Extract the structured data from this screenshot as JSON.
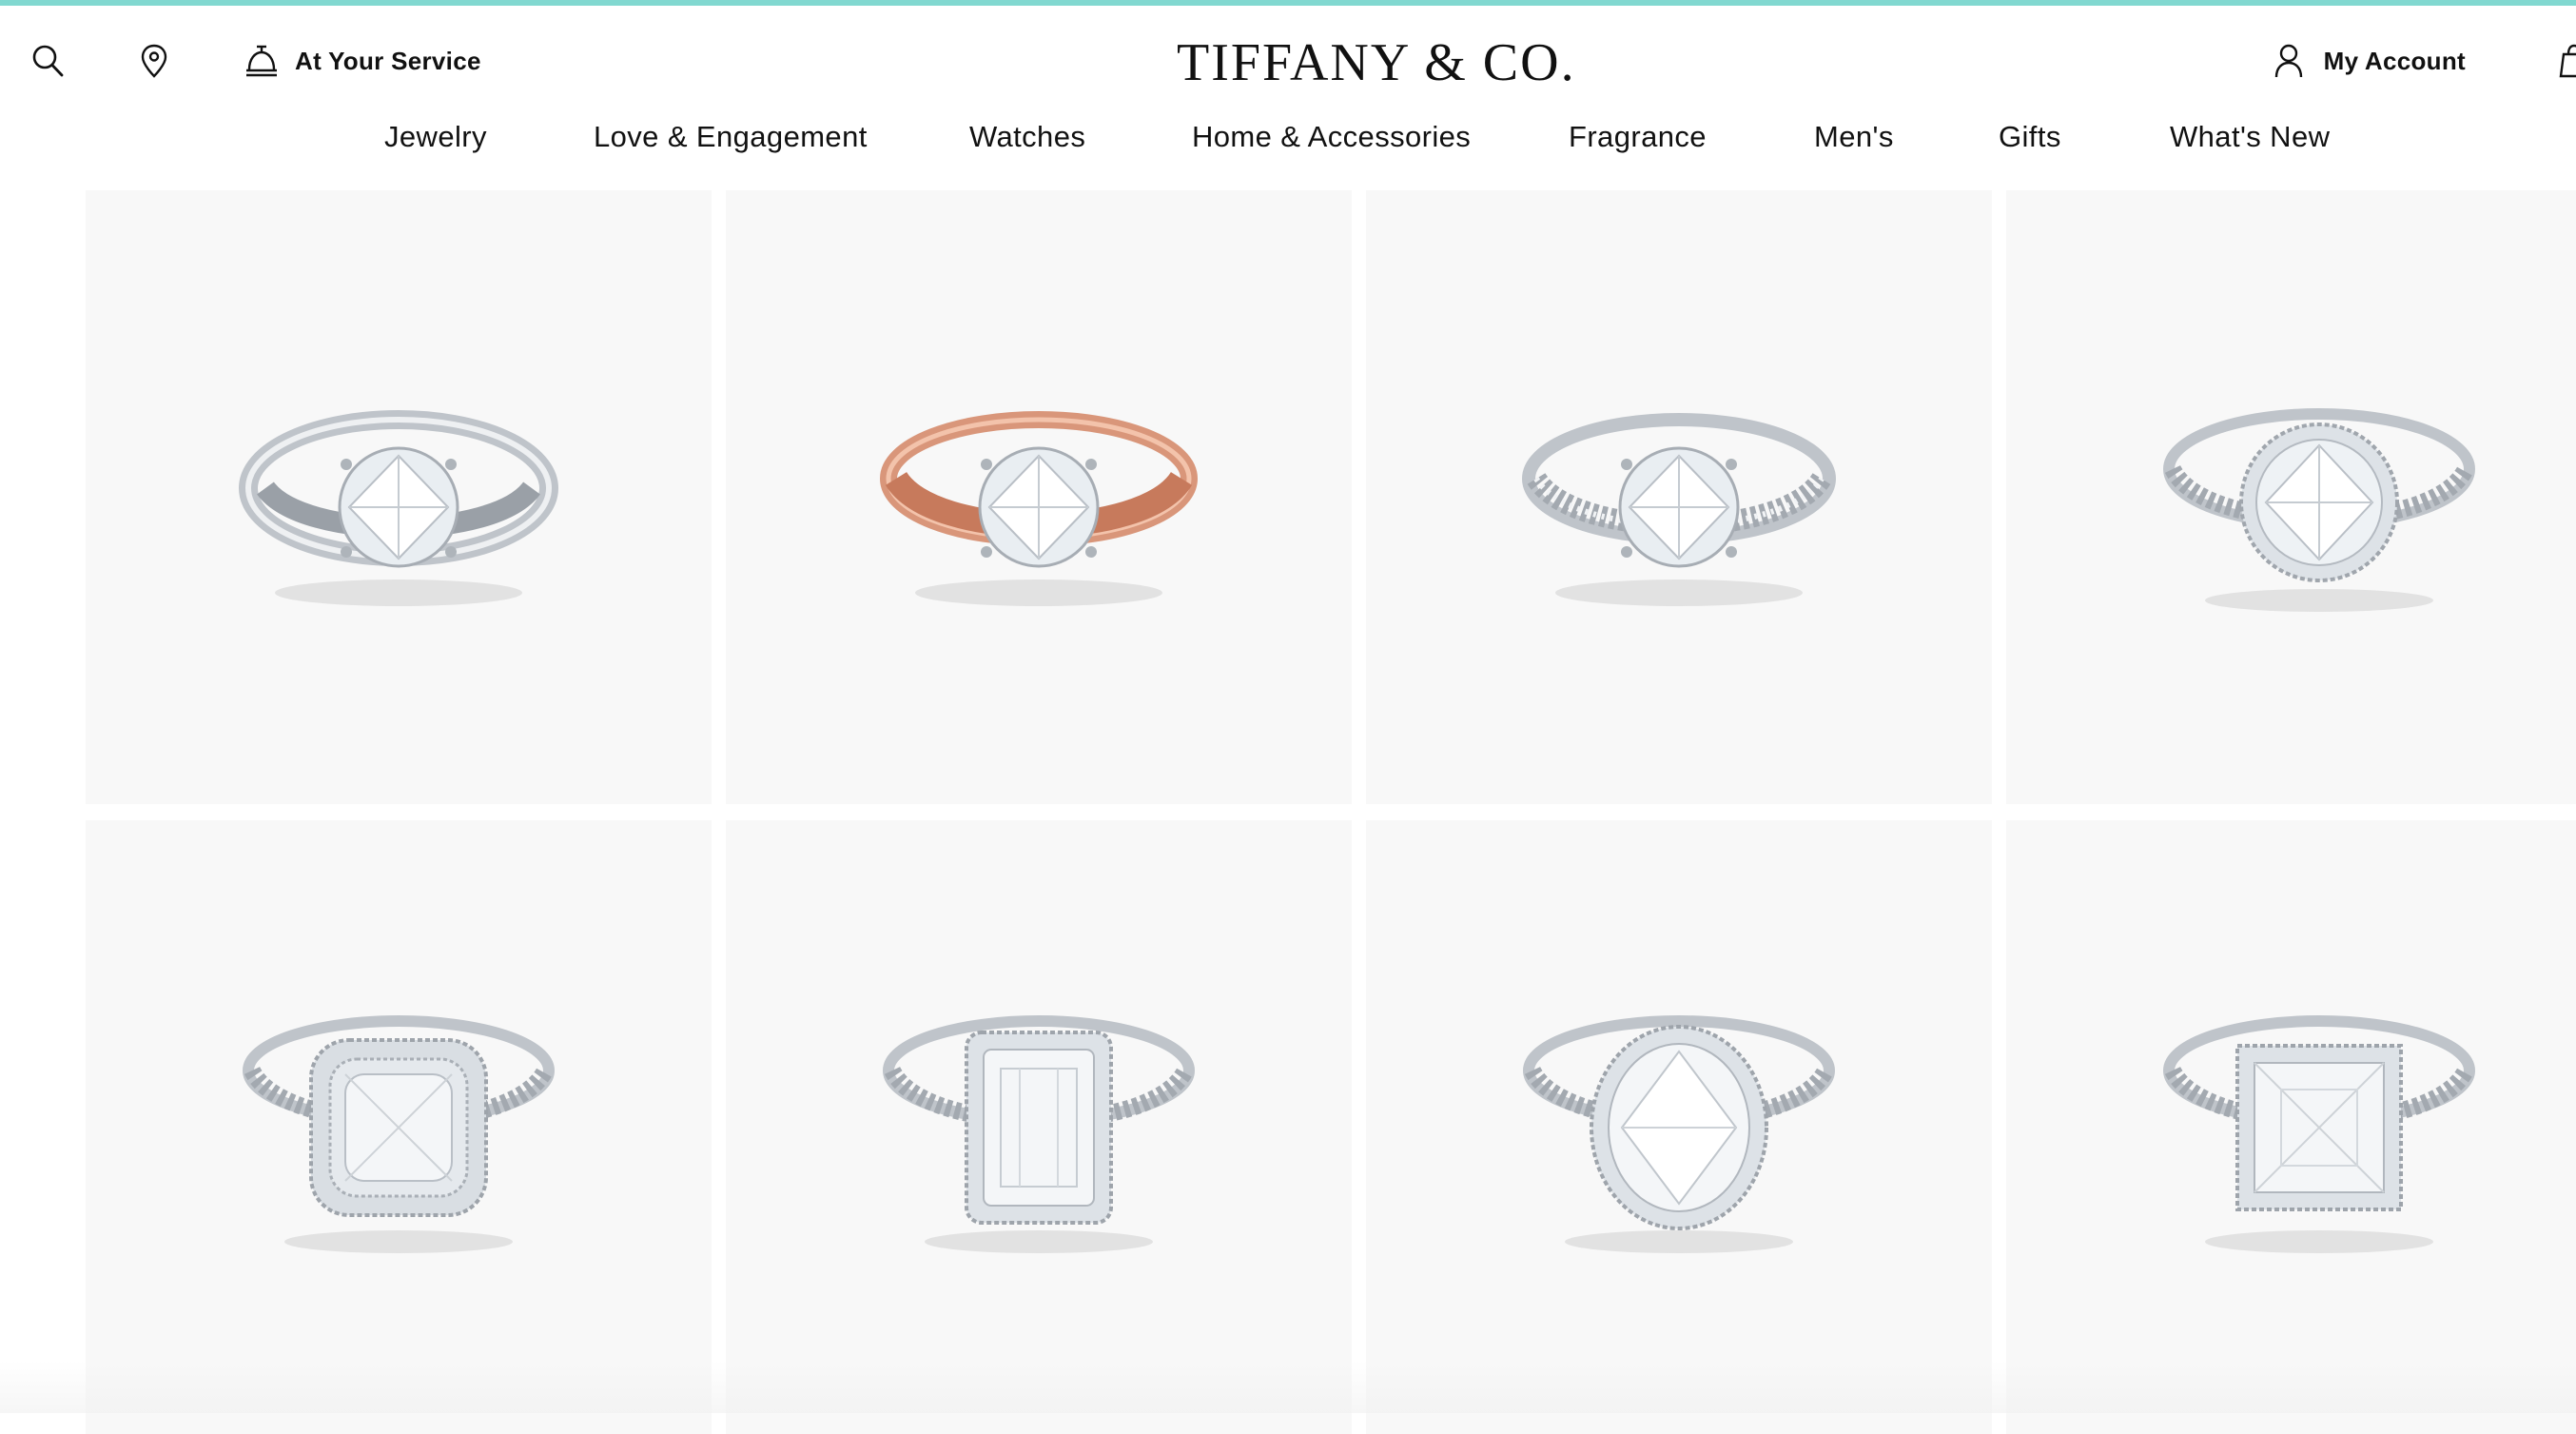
{
  "brand": {
    "logo_text": "TIFFANY & CO.",
    "accent_color": "#81d8d0"
  },
  "header": {
    "service_label": "At Your Service",
    "account_label": "My Account",
    "icons": {
      "search": "search-icon",
      "location": "location-pin-icon",
      "service": "service-bell-icon",
      "account": "person-icon",
      "bag": "shopping-bag-icon"
    }
  },
  "nav": {
    "items": [
      {
        "label": "Jewelry"
      },
      {
        "label": "Love & Engagement"
      },
      {
        "label": "Watches"
      },
      {
        "label": "Home & Accessories"
      },
      {
        "label": "Fragrance"
      },
      {
        "label": "Men's"
      },
      {
        "label": "Gifts"
      },
      {
        "label": "What's New"
      }
    ]
  },
  "products": [
    {
      "style": "solitaire-platinum",
      "metal": "#cfd3d8",
      "stone": "round"
    },
    {
      "style": "solitaire-rose-gold",
      "metal": "#d9967a",
      "stone": "round"
    },
    {
      "style": "pave-band-solitaire",
      "metal": "#cfd3d8",
      "stone": "round"
    },
    {
      "style": "round-halo",
      "metal": "#cfd3d8",
      "stone": "round-halo"
    },
    {
      "style": "cushion-double-halo",
      "metal": "#cfd3d8",
      "stone": "cushion-halo"
    },
    {
      "style": "emerald-cut-halo",
      "metal": "#cfd3d8",
      "stone": "emerald-halo"
    },
    {
      "style": "oval-halo",
      "metal": "#cfd3d8",
      "stone": "oval-halo"
    },
    {
      "style": "princess-halo",
      "metal": "#cfd3d8",
      "stone": "princess-halo"
    }
  ]
}
